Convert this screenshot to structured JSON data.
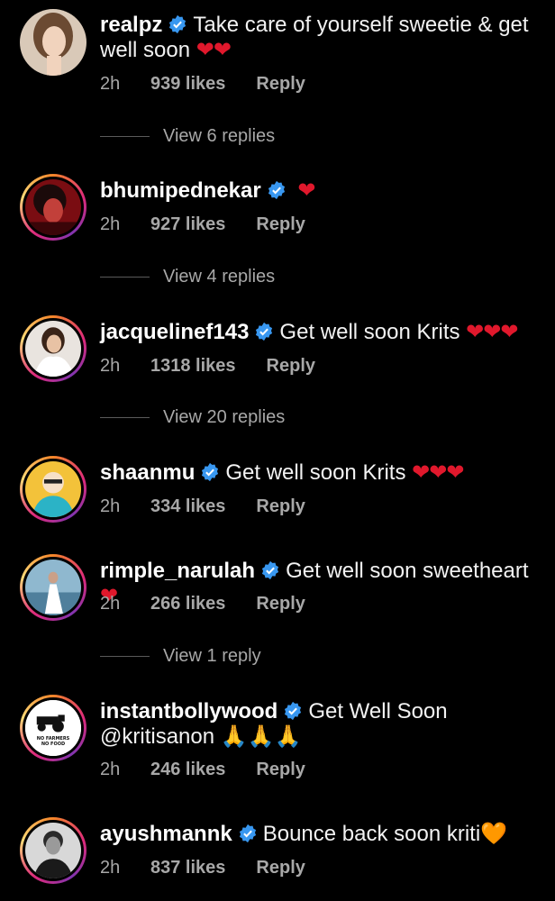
{
  "comments": [
    {
      "username": "realpz",
      "text": "Take care of yourself sweetie & get well soon",
      "emoji": "❤❤",
      "time": "2h",
      "likes": "939 likes",
      "reply": "Reply",
      "view_replies": "View 6 replies"
    },
    {
      "username": "bhumipednekar",
      "text": "",
      "emoji": "❤",
      "time": "2h",
      "likes": "927 likes",
      "reply": "Reply",
      "view_replies": "View 4 replies"
    },
    {
      "username": "jacquelinef143",
      "text": "Get well soon Krits",
      "emoji": "❤❤❤",
      "time": "2h",
      "likes": "1318 likes",
      "reply": "Reply",
      "view_replies": "View 20 replies"
    },
    {
      "username": "shaanmu",
      "text": "Get well soon Krits",
      "emoji": "❤❤❤",
      "time": "2h",
      "likes": "334 likes",
      "reply": "Reply"
    },
    {
      "username": "rimple_narulah",
      "text": "Get well soon sweetheart",
      "emoji": "❤",
      "time": "2h",
      "likes": "266 likes",
      "reply": "Reply",
      "view_replies": "View 1 reply"
    },
    {
      "username": "instantbollywood",
      "text": "Get Well Soon @kritisanon",
      "emoji": "🙏🙏🙏",
      "time": "2h",
      "likes": "246 likes",
      "reply": "Reply",
      "avatar_text": "NO FARMERS NO FOOD"
    },
    {
      "username": "ayushmannk",
      "text": "Bounce back soon kriti",
      "emoji": "🧡",
      "time": "2h",
      "likes": "837 likes",
      "reply": "Reply"
    }
  ],
  "colors": {
    "background": "#000000",
    "verified": "#3897f0",
    "heart": "#e0182c",
    "meta": "#a8a8a8"
  }
}
